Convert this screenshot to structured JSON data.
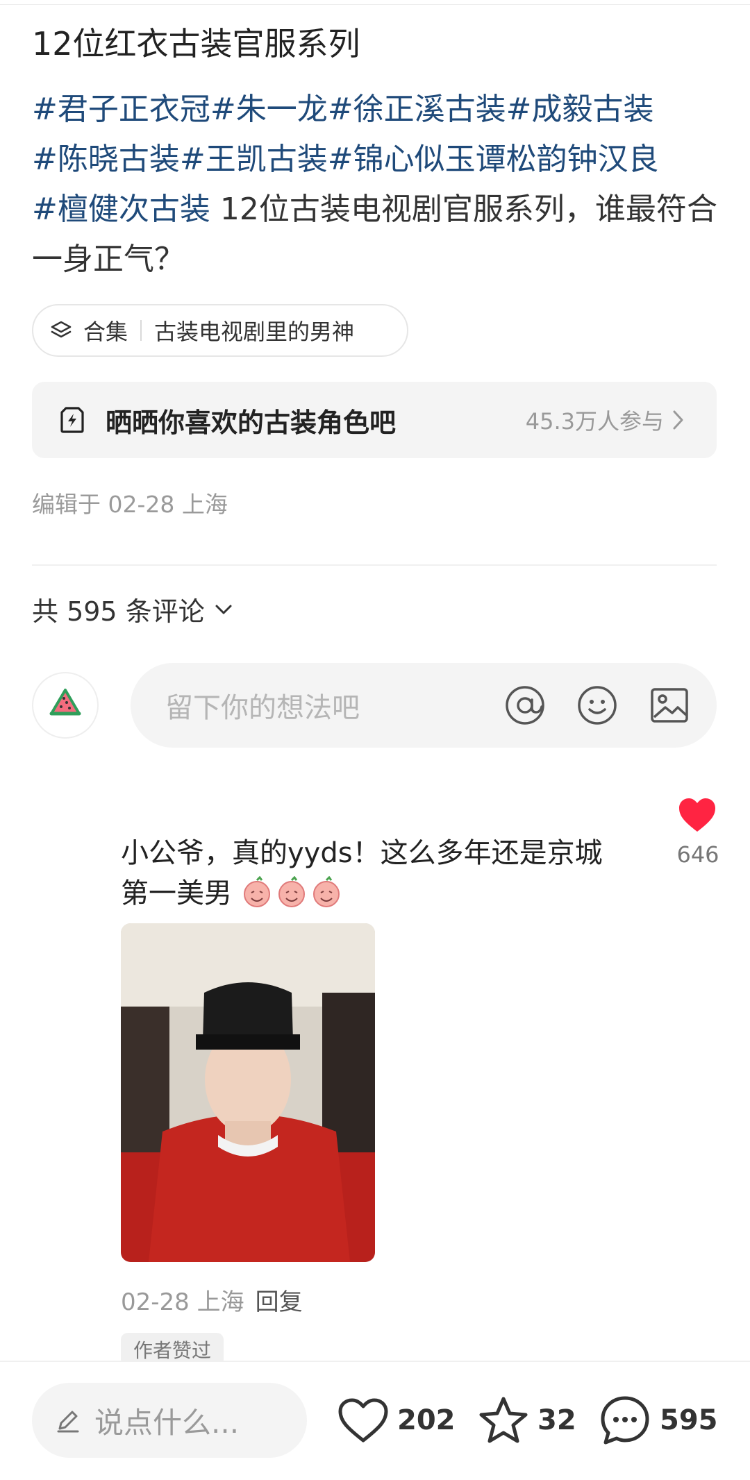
{
  "post": {
    "title": "12位红衣古装官服系列",
    "tags": [
      "#君子正衣冠",
      "#朱一龙",
      "#徐正溪古装",
      "#成毅古装",
      "#陈晓古装",
      "#王凯古装",
      "#锦心似玉谭松韵钟汉良",
      "#檀健次古装"
    ],
    "text": " 12位古装电视剧官服系列，谁最符合一身正气？",
    "collection_label": "合集",
    "collection_name": "古装电视剧里的男神",
    "topic_title": "晒晒你喜欢的古装角色吧",
    "topic_count": "45.3万人参与",
    "edit_info": "编辑于 02-28 上海"
  },
  "comments_header": {
    "count_text": "共 595 条评论"
  },
  "comment_input": {
    "placeholder": "留下你的想法吧"
  },
  "comment": {
    "line1": "小公爷，真的yyds！这么多年还是京城",
    "line2": "第一美男",
    "likes": "646",
    "date_location": "02-28 上海",
    "reply_label": "回复",
    "author_badge": "作者赞过"
  },
  "bottom_bar": {
    "input_placeholder": "说点什么...",
    "likes": "202",
    "stars": "32",
    "comments": "595"
  },
  "colors": {
    "tag": "#1f4a7a",
    "heart": "#ff2442"
  }
}
